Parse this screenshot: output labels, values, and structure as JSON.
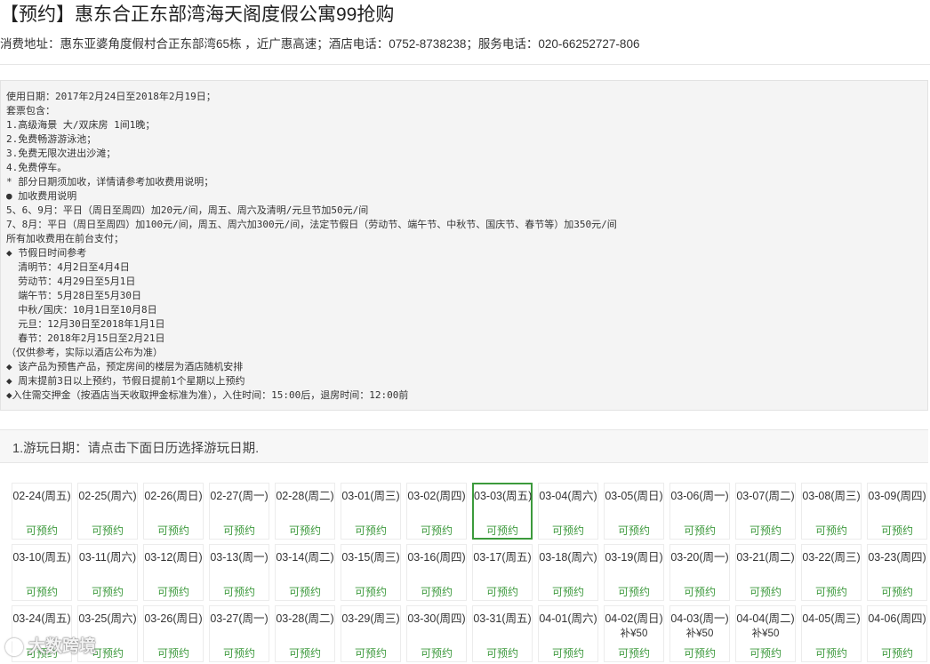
{
  "header": {
    "title": "【预约】惠东合正东部湾海天阁度假公寓99抢购",
    "address": "消费地址：惠东亚婆角度假村合正东部湾65栋 ，近广惠高速；酒店电话：0752-8738238；服务电话：020-66252727-806"
  },
  "description": {
    "lines": [
      "使用日期：2017年2月24日至2018年2月19日；",
      "套票包含：",
      "1.高级海景 大/双床房 1间1晚；",
      "2.免费畅游游泳池；",
      "3.免费无限次进出沙滩；",
      "4.免费停车。",
      "* 部分日期须加收，详情请参考加收费用说明；",
      "● 加收费用说明",
      "5、6、9月：平日（周日至周四）加20元/间，周五、周六及清明/元旦节加50元/间",
      "7、8月：平日（周日至周四）加100元/间，周五、周六加300元/间，法定节假日（劳动节、端午节、中秋节、国庆节、春节等）加350元/间",
      "所有加收费用在前台支付；",
      "◆ 节假日时间参考",
      "  清明节：4月2日至4月4日",
      "  劳动节：4月29日至5月1日",
      "  端午节：5月28日至5月30日",
      "  中秋/国庆：10月1日至10月8日",
      "  元旦：12月30日至2018年1月1日",
      "  春节：2018年2月15日至2月21日",
      "（仅供参考，实际以酒店公布为准）",
      "◆ 该产品为预售产品，预定房间的楼层为酒店随机安排",
      "◆ 周末提前3日以上预约，节假日提前1个星期以上预约",
      "◆入住需交押金（按酒店当天收取押金标准为准），入住时间：15:00后，退房时间：12:00前"
    ]
  },
  "step": {
    "label": "1.游玩日期：请点击下面日历选择游玩日期."
  },
  "calendar": {
    "accent_color": "#3e9a3e",
    "selected_border_color": "#3c9a3c",
    "days": [
      {
        "date": "02-24(周五)",
        "status": "可预约"
      },
      {
        "date": "02-25(周六)",
        "status": "可预约"
      },
      {
        "date": "02-26(周日)",
        "status": "可预约"
      },
      {
        "date": "02-27(周一)",
        "status": "可预约"
      },
      {
        "date": "02-28(周二)",
        "status": "可预约"
      },
      {
        "date": "03-01(周三)",
        "status": "可预约"
      },
      {
        "date": "03-02(周四)",
        "status": "可预约"
      },
      {
        "date": "03-03(周五)",
        "status": "可预约",
        "selected": true
      },
      {
        "date": "03-04(周六)",
        "status": "可预约"
      },
      {
        "date": "03-05(周日)",
        "status": "可预约"
      },
      {
        "date": "03-06(周一)",
        "status": "可预约"
      },
      {
        "date": "03-07(周二)",
        "status": "可预约"
      },
      {
        "date": "03-08(周三)",
        "status": "可预约"
      },
      {
        "date": "03-09(周四)",
        "status": "可预约"
      },
      {
        "date": "03-10(周五)",
        "status": "可预约"
      },
      {
        "date": "03-11(周六)",
        "status": "可预约"
      },
      {
        "date": "03-12(周日)",
        "status": "可预约"
      },
      {
        "date": "03-13(周一)",
        "status": "可预约"
      },
      {
        "date": "03-14(周二)",
        "status": "可预约"
      },
      {
        "date": "03-15(周三)",
        "status": "可预约"
      },
      {
        "date": "03-16(周四)",
        "status": "可预约"
      },
      {
        "date": "03-17(周五)",
        "status": "可预约"
      },
      {
        "date": "03-18(周六)",
        "status": "可预约"
      },
      {
        "date": "03-19(周日)",
        "status": "可预约"
      },
      {
        "date": "03-20(周一)",
        "status": "可预约"
      },
      {
        "date": "03-21(周二)",
        "status": "可预约"
      },
      {
        "date": "03-22(周三)",
        "status": "可预约"
      },
      {
        "date": "03-23(周四)",
        "status": "可预约"
      },
      {
        "date": "03-24(周五)",
        "status": "可预约"
      },
      {
        "date": "03-25(周六)",
        "status": "可预约"
      },
      {
        "date": "03-26(周日)",
        "status": "可预约"
      },
      {
        "date": "03-27(周一)",
        "status": "可预约"
      },
      {
        "date": "03-28(周二)",
        "status": "可预约"
      },
      {
        "date": "03-29(周三)",
        "status": "可预约"
      },
      {
        "date": "03-30(周四)",
        "status": "可预约"
      },
      {
        "date": "03-31(周五)",
        "status": "可预约"
      },
      {
        "date": "04-01(周六)",
        "status": "可预约"
      },
      {
        "date": "04-02(周日)",
        "status": "可预约",
        "surcharge": "补¥50"
      },
      {
        "date": "04-03(周一)",
        "status": "可预约",
        "surcharge": "补¥50"
      },
      {
        "date": "04-04(周二)",
        "status": "可预约",
        "surcharge": "补¥50"
      },
      {
        "date": "04-05(周三)",
        "status": "可预约"
      },
      {
        "date": "04-06(周四)",
        "status": "可预约"
      }
    ]
  },
  "watermark": {
    "text": "大数跨境"
  }
}
